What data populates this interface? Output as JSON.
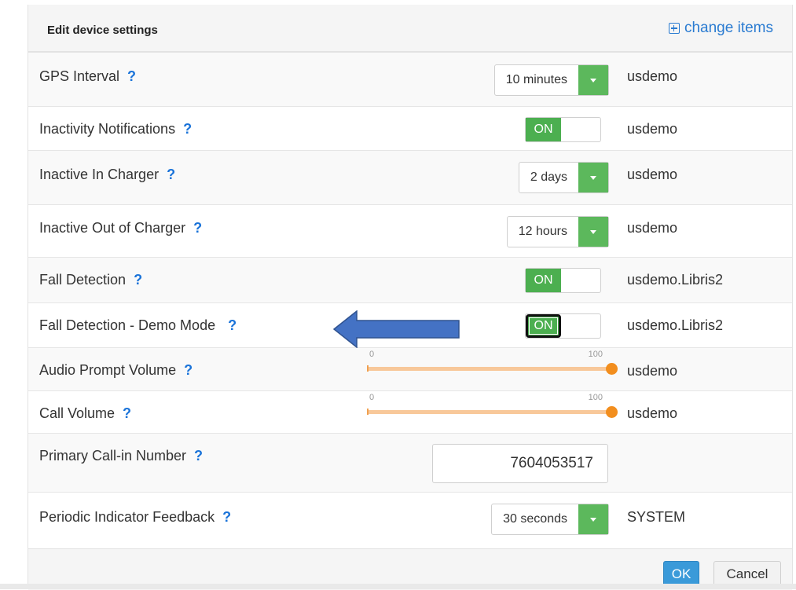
{
  "header": {
    "title": "Edit device settings",
    "change_items": "change items"
  },
  "rows": [
    {
      "label": "GPS Interval",
      "control": "select",
      "value": "10 minutes",
      "user": "usdemo"
    },
    {
      "label": "Inactivity Notifications",
      "control": "toggle",
      "value": "ON",
      "user": "usdemo"
    },
    {
      "label": "Inactive In Charger",
      "control": "select",
      "value": "2 days",
      "user": "usdemo"
    },
    {
      "label": "Inactive Out of Charger",
      "control": "select",
      "value": "12 hours",
      "user": "usdemo"
    },
    {
      "label": "Fall Detection",
      "control": "toggle",
      "value": "ON",
      "user": "usdemo.Libris2"
    },
    {
      "label": "Fall Detection - Demo Mode",
      "control": "toggle",
      "value": "ON",
      "user": "usdemo.Libris2"
    },
    {
      "label": "Audio Prompt Volume",
      "control": "slider",
      "min_label": "0",
      "max_label": "100",
      "value": 100,
      "user": "usdemo"
    },
    {
      "label": "Call Volume",
      "control": "slider",
      "min_label": "0",
      "max_label": "100",
      "value": 100,
      "user": "usdemo"
    },
    {
      "label": "Primary Call-in Number",
      "control": "input",
      "value": "7604053517",
      "user": ""
    },
    {
      "label": "Periodic Indicator Feedback",
      "control": "select",
      "value": "30 seconds",
      "user": "SYSTEM"
    }
  ],
  "help_glyph": "?",
  "footer": {
    "ok_label": "OK",
    "cancel_label": "Cancel"
  },
  "colors": {
    "toggle_on": "#4caf50",
    "select_button": "#5cb85c",
    "slider_handle": "#f28e1e",
    "link": "#2a7bd1",
    "annotation_arrow": "#4472c4"
  }
}
